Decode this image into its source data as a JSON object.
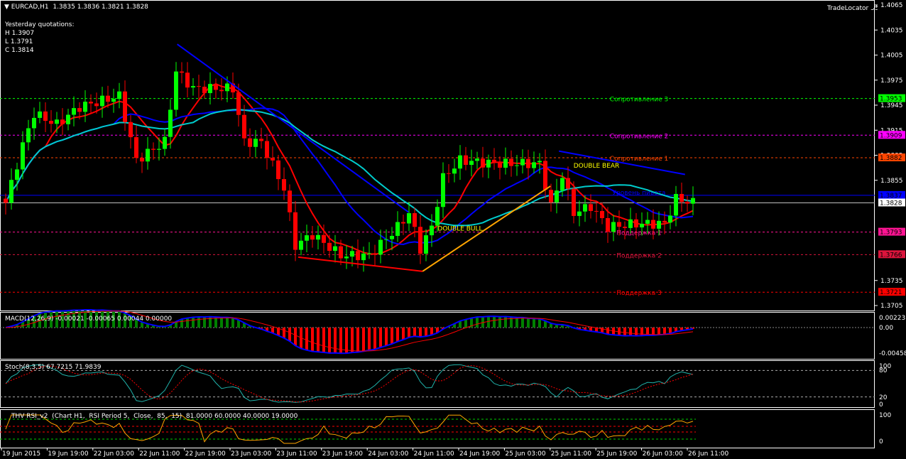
{
  "header": {
    "symbol": "EURCAD,H1",
    "ohlc": "1.3835 1.3836 1.3821 1.3828",
    "yesterday_title": "Yesterday quotations:",
    "high": "H 1.3907",
    "low": "L 1.3791",
    "close": "C 1.3814",
    "brand": "TradeLocator"
  },
  "chart_data": {
    "type": "candlestick",
    "symbol": "EURCAD",
    "timeframe": "H1",
    "ylim": [
      1.3705,
      1.4065
    ],
    "bars": 122,
    "close_keypoints": [
      [
        0,
        1.3828
      ],
      [
        3,
        1.3897
      ],
      [
        5,
        1.3935
      ],
      [
        9,
        1.3922
      ],
      [
        13,
        1.3943
      ],
      [
        20,
        1.3956
      ],
      [
        23,
        1.3879
      ],
      [
        28,
        1.3901
      ],
      [
        30,
        1.3986
      ],
      [
        33,
        1.3965
      ],
      [
        40,
        1.3965
      ],
      [
        42,
        1.3901
      ],
      [
        45,
        1.3901
      ],
      [
        49,
        1.3845
      ],
      [
        51,
        1.3777
      ],
      [
        54,
        1.379
      ],
      [
        59,
        1.3765
      ],
      [
        64,
        1.3765
      ],
      [
        69,
        1.3799
      ],
      [
        71,
        1.3816
      ],
      [
        73,
        1.3773
      ],
      [
        75,
        1.3799
      ],
      [
        77,
        1.3858
      ],
      [
        80,
        1.3879
      ],
      [
        86,
        1.3875
      ],
      [
        94,
        1.3875
      ],
      [
        96,
        1.3824
      ],
      [
        98,
        1.3862
      ],
      [
        100,
        1.3816
      ],
      [
        103,
        1.3824
      ],
      [
        106,
        1.3799
      ],
      [
        111,
        1.3803
      ],
      [
        116,
        1.3803
      ],
      [
        118,
        1.3833
      ],
      [
        121,
        1.3828
      ]
    ],
    "price_ticks": [
      "1.4065",
      "1.4035",
      "1.4005",
      "1.3975",
      "1.3945",
      "1.3915",
      "1.3885",
      "1.3855",
      "1.3735",
      "1.3705"
    ],
    "levels": [
      {
        "name": "Сопротивление 3",
        "price": 1.3953,
        "label": "1.3953",
        "color": "#00ff00",
        "style": "dash"
      },
      {
        "name": "Сопротивление 2",
        "price": 1.3909,
        "label": "1.3909",
        "color": "#ff00ff",
        "style": "dash"
      },
      {
        "name": "Сопротивление 1",
        "price": 1.3882,
        "label": "1.3882",
        "color": "#ff4500",
        "style": "dash"
      },
      {
        "name": "Уровень пивота",
        "price": 1.3837,
        "label": "1.3837",
        "color": "#0000ff",
        "style": "solid"
      },
      {
        "name": "",
        "price": 1.3828,
        "label": "1.3828",
        "color": "#c0c0c0",
        "style": "solid"
      },
      {
        "name": "Поддержка 1",
        "price": 1.3793,
        "label": "1.3793",
        "color": "#ff1493",
        "style": "dash"
      },
      {
        "name": "Поддержка 2",
        "price": 1.3766,
        "label": "1.3766",
        "color": "#dc143c",
        "style": "dash"
      },
      {
        "name": "Поддержка 3",
        "price": 1.3721,
        "label": "1.3721",
        "color": "#ff0000",
        "style": "dash"
      }
    ],
    "trendlines": [
      {
        "from": [
          30.2,
          1.4018
        ],
        "to": [
          70.9,
          1.3817
        ],
        "color": "#0000ff"
      },
      {
        "from": [
          51.5,
          1.3763
        ],
        "to": [
          73.4,
          1.3746
        ],
        "color": "#ff0000"
      },
      {
        "from": [
          73.4,
          1.3746
        ],
        "to": [
          95.9,
          1.3848
        ],
        "color": "#ffa500"
      },
      {
        "from": [
          97.4,
          1.389
        ],
        "to": [
          119.6,
          1.3862
        ],
        "color": "#0000ff"
      }
    ],
    "annotations": [
      {
        "text": "DOUBLE BULL",
        "bar": 80,
        "price": 1.3795,
        "color": "#ffff00"
      },
      {
        "text": "DOUBLE BEAR",
        "bar": 104,
        "price": 1.387,
        "color": "#ffff00"
      }
    ],
    "x_ticks": [
      "19 Jun 2015",
      "19 Jun 19:00",
      "22 Jun 03:00",
      "22 Jun 11:00",
      "22 Jun 19:00",
      "23 Jun 03:00",
      "23 Jun 11:00",
      "23 Jun 19:00",
      "24 Jun 03:00",
      "24 Jun 11:00",
      "24 Jun 19:00",
      "25 Jun 03:00",
      "25 Jun 11:00",
      "25 Jun 19:00",
      "26 Jun 03:00",
      "26 Jun 11:00"
    ],
    "macd": {
      "title": "MACD(12,26,9) -0.00021 -0.00065 0.00044 0.00000",
      "ticks": [
        "0.00223",
        "0.00",
        "-0.00458"
      ]
    },
    "stoch": {
      "title": "Stoch(8,3,5) 67.7215 71.9839",
      "ticks": [
        "100",
        "80",
        "20",
        "0"
      ]
    },
    "rsi": {
      "title": "THV RSI_v2  (Chart H1,  RSI Period 5,  Close,  85,  15)  81.0000 60.0000 40.0000 19.0000",
      "ticks": [
        "100",
        "0"
      ]
    }
  }
}
